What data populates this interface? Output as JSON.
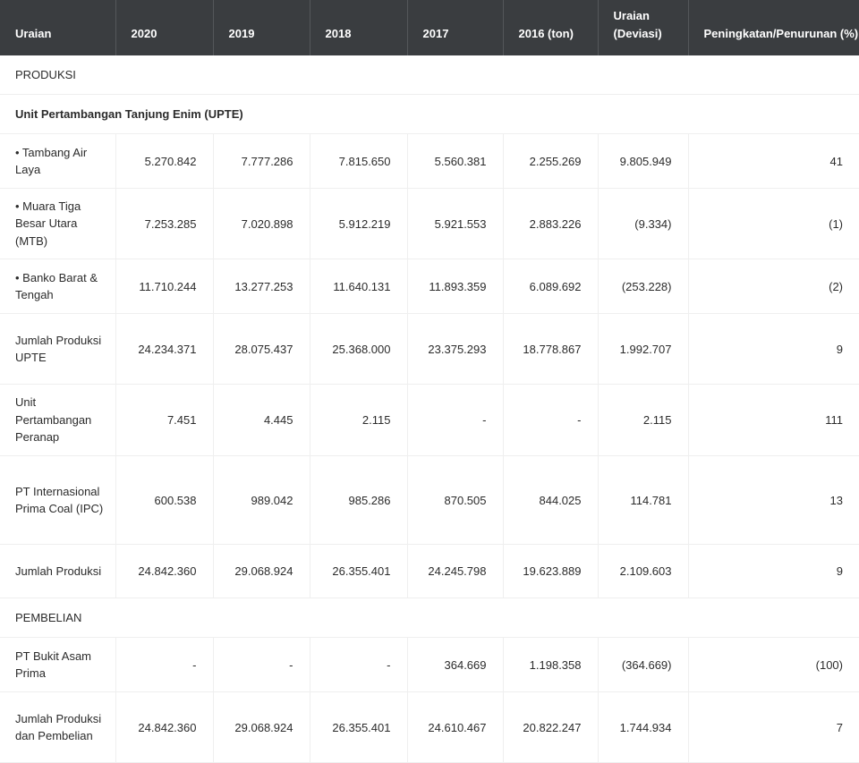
{
  "headers": [
    "Uraian",
    "2020",
    "2019",
    "2018",
    "2017",
    "2016 (ton)",
    "Uraian (Deviasi)",
    "Peningkatan/Penurunan (%)"
  ],
  "sections": {
    "produksi": "PRODUKSI",
    "upte": "Unit Pertambangan Tanjung Enim (UPTE)",
    "pembelian": "PEMBELIAN"
  },
  "rows": [
    {
      "label": "• Tambang Air Laya",
      "values": [
        "5.270.842",
        "7.777.286",
        "7.815.650",
        "5.560.381",
        "2.255.269",
        "9.805.949",
        "41"
      ]
    },
    {
      "label": "• Muara Tiga Besar Utara (MTB)",
      "values": [
        "7.253.285",
        "7.020.898",
        "5.912.219",
        "5.921.553",
        "2.883.226",
        "(9.334)",
        "(1)"
      ]
    },
    {
      "label": "• Banko Barat & Tengah",
      "values": [
        "11.710.244",
        "13.277.253",
        "11.640.131",
        "11.893.359",
        "6.089.692",
        "(253.228)",
        "(2)"
      ]
    },
    {
      "label": "Jumlah Produksi UPTE",
      "values": [
        "24.234.371",
        "28.075.437",
        "25.368.000",
        "23.375.293",
        "18.778.867",
        "1.992.707",
        "9"
      ]
    },
    {
      "label": "Unit Pertambangan Peranap",
      "values": [
        "7.451",
        "4.445",
        "2.115",
        "-",
        "-",
        "2.115",
        "111"
      ]
    },
    {
      "label": "PT Internasional Prima Coal (IPC)",
      "values": [
        "600.538",
        "989.042",
        "985.286",
        "870.505",
        "844.025",
        "114.781",
        "13"
      ]
    },
    {
      "label": "Jumlah Produksi",
      "values": [
        "24.842.360",
        "29.068.924",
        "26.355.401",
        "24.245.798",
        "19.623.889",
        "2.109.603",
        "9"
      ]
    },
    {
      "label": "PT Bukit Asam Prima",
      "values": [
        "-",
        "-",
        "-",
        "364.669",
        "1.198.358",
        "(364.669)",
        "(100)"
      ]
    },
    {
      "label": "Jumlah Produksi dan Pembelian",
      "values": [
        "24.842.360",
        "29.068.924",
        "26.355.401",
        "24.610.467",
        "20.822.247",
        "1.744.934",
        "7"
      ]
    }
  ]
}
